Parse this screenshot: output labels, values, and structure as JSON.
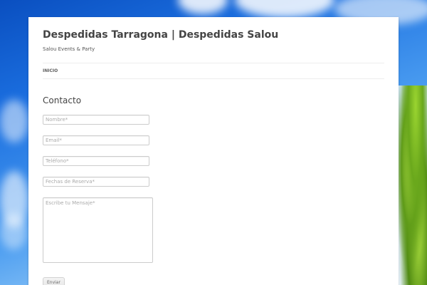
{
  "site": {
    "title": "Despedidas Tarragona | Despedidas Salou",
    "tagline": "Salou Events & Party"
  },
  "nav": {
    "items": [
      {
        "label": "INICIO"
      }
    ]
  },
  "page": {
    "title": "Contacto"
  },
  "form": {
    "nombre_placeholder": "Nombre*",
    "email_placeholder": "Email*",
    "telefono_placeholder": "Teléfono*",
    "fechas_placeholder": "Fechas de Reserva*",
    "mensaje_placeholder": "Escribe tu Mensaje*",
    "submit_label": "Enviar"
  },
  "colors": {
    "sky": "#1b6fe0",
    "palm": "#6aa81c",
    "page_background": "#ffffff"
  }
}
